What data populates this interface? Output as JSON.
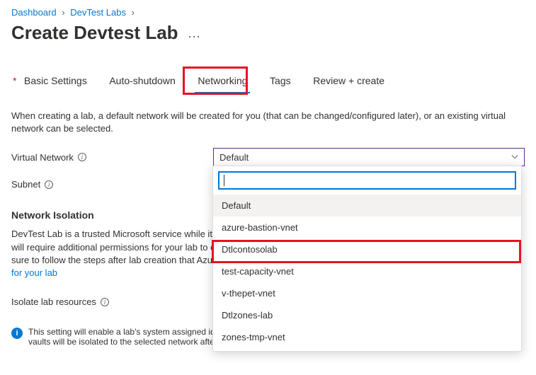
{
  "breadcrumb": {
    "items": [
      "Dashboard",
      "DevTest Labs"
    ]
  },
  "page": {
    "title": "Create Devtest Lab",
    "more_label": "···"
  },
  "tabs": {
    "items": [
      {
        "label": "Basic Settings",
        "required": true
      },
      {
        "label": "Auto-shutdown"
      },
      {
        "label": "Networking",
        "selected": true
      },
      {
        "label": "Tags"
      },
      {
        "label": "Review + create"
      }
    ]
  },
  "description": "When creating a lab, a default network will be created for you (that can be changed/configured later), or an existing virtual network can be selected.",
  "fields": {
    "vnet": {
      "label": "Virtual Network",
      "value": "Default"
    },
    "subnet": {
      "label": "Subnet"
    }
  },
  "isolation": {
    "heading": "Network Isolation",
    "text_prefix": "DevTest Lab is a trusted Microsoft service while it acts on your behalf to perform lab operations. Enabling network isolation will require additional permissions for your lab to connect to Azure resources such as key vault and storage accounts, so be sure to follow the steps after lab creation that Azure creates and manages for you. ",
    "link_text": "Learn more on achieving network isolation for your lab",
    "label_isolate": "Isolate lab resources"
  },
  "note": {
    "text": "This setting will enable a lab's system assigned identity permission on newly created lab resources. Lab storage accounts and key vaults will be isolated to the selected network after lab creation."
  },
  "dropdown": {
    "search_placeholder": "",
    "options": [
      "Default",
      "azure-bastion-vnet",
      "Dtlcontosolab",
      "test-capacity-vnet",
      "v-thepet-vnet",
      "Dtlzones-lab",
      "zones-tmp-vnet"
    ]
  }
}
